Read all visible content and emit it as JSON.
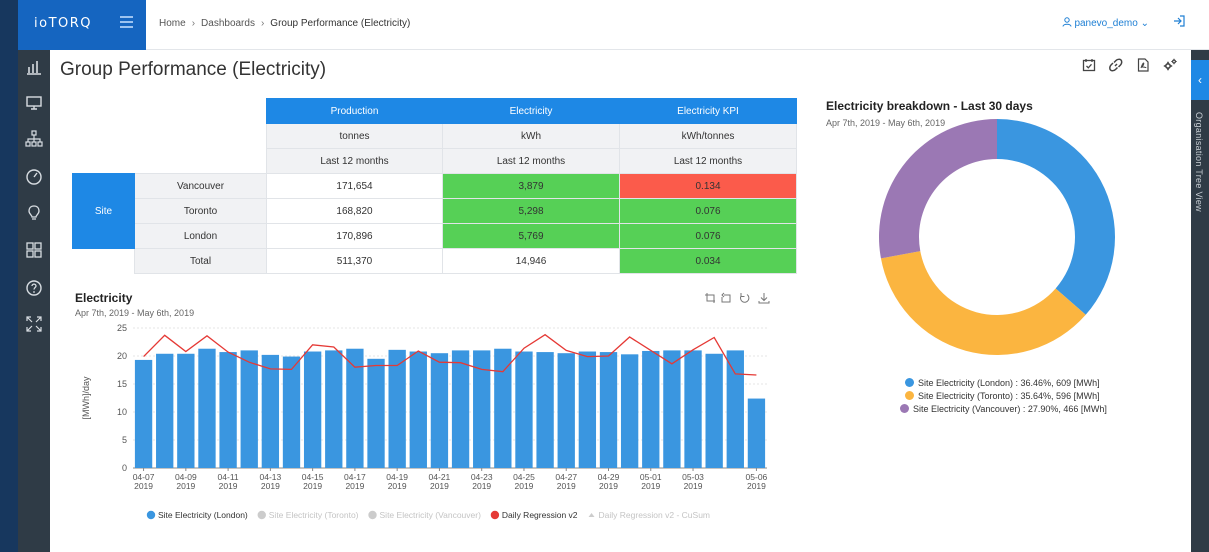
{
  "brand": {
    "name": "ioTORQ"
  },
  "breadcrumb": {
    "items": [
      "Home",
      "Dashboards",
      "Group Performance (Electricity)"
    ]
  },
  "user": {
    "name": "panevo_demo"
  },
  "page": {
    "title": "Group Performance (Electricity)"
  },
  "toolbar": {
    "icons": [
      "calendar-check-icon",
      "link-icon",
      "pdf-icon",
      "settings-gears-icon"
    ]
  },
  "nav": {
    "icons": [
      "bar-chart-icon",
      "monitor-icon",
      "hierarchy-icon",
      "gauge-icon",
      "lightbulb-icon",
      "grid-icon",
      "help-icon",
      "expand-icon"
    ]
  },
  "kpi_table": {
    "headers": [
      "Production",
      "Electricity",
      "Electricity KPI"
    ],
    "units": [
      "tonnes",
      "kWh",
      "kWh/tonnes"
    ],
    "periods": [
      "Last 12 months",
      "Last 12 months",
      "Last 12 months"
    ],
    "group_label": "Site",
    "rows": [
      {
        "label": "Vancouver",
        "production": "171,654",
        "electricity": "3,879",
        "kpi": "0.134"
      },
      {
        "label": "Toronto",
        "production": "168,820",
        "electricity": "5,298",
        "kpi": "0.076"
      },
      {
        "label": "London",
        "production": "170,896",
        "electricity": "5,769",
        "kpi": "0.076"
      }
    ],
    "total": {
      "label": "Total",
      "production": "511,370",
      "electricity": "14,946",
      "kpi": "0.034"
    },
    "colors": {
      "header": "#1e88e5",
      "good": "#56d056",
      "bad": "#fb5b4b"
    }
  },
  "electricity_chart": {
    "title": "Electricity",
    "range": "Apr 7th, 2019   -   May 6th, 2019",
    "tool_icons": [
      "zoom-area-icon",
      "zoom-reset-icon",
      "restore-icon",
      "download-icon"
    ]
  },
  "breakdown": {
    "title": "Electricity breakdown - Last 30 days",
    "range": "Apr 7th, 2019   -   May 6th, 2019"
  },
  "right_panel": {
    "label": "Organisation Tree View"
  },
  "chart_data": [
    {
      "type": "bar",
      "ylabel": "[MWh]/day",
      "ylim": [
        0,
        25
      ],
      "yticks": [
        "0",
        "5",
        "10",
        "15",
        "20",
        "25"
      ],
      "x": [
        "04-07",
        "04-08",
        "04-09",
        "04-10",
        "04-11",
        "04-12",
        "04-13",
        "04-14",
        "04-15",
        "04-16",
        "04-17",
        "04-18",
        "04-19",
        "04-20",
        "04-21",
        "04-22",
        "04-23",
        "04-24",
        "04-25",
        "04-26",
        "04-27",
        "04-28",
        "04-29",
        "04-30",
        "05-01",
        "05-02",
        "05-03",
        "05-04",
        "05-05",
        "05-06"
      ],
      "tick_labels": [
        {
          "top": "04-07",
          "bottom": "2019"
        },
        {
          "top": "04-09",
          "bottom": "2019"
        },
        {
          "top": "04-11",
          "bottom": "2019"
        },
        {
          "top": "04-13",
          "bottom": "2019"
        },
        {
          "top": "04-15",
          "bottom": "2019"
        },
        {
          "top": "04-17",
          "bottom": "2019"
        },
        {
          "top": "04-19",
          "bottom": "2019"
        },
        {
          "top": "04-21",
          "bottom": "2019"
        },
        {
          "top": "04-23",
          "bottom": "2019"
        },
        {
          "top": "04-25",
          "bottom": "2019"
        },
        {
          "top": "04-27",
          "bottom": "2019"
        },
        {
          "top": "04-29",
          "bottom": "2019"
        },
        {
          "top": "05-01",
          "bottom": "2019"
        },
        {
          "top": "05-03",
          "bottom": "2019"
        },
        {
          "top": "05-06",
          "bottom": "2019"
        }
      ],
      "series": [
        {
          "name": "Site Electricity (London)",
          "kind": "bar",
          "color": "#3a96e0",
          "visible": true,
          "values": [
            19.3,
            20.4,
            20.4,
            21.3,
            20.7,
            21.0,
            20.2,
            19.9,
            20.8,
            21.0,
            21.3,
            19.5,
            21.1,
            20.8,
            20.5,
            21.0,
            21.0,
            21.3,
            20.8,
            20.7,
            20.5,
            20.8,
            20.7,
            20.3,
            20.9,
            21.0,
            21.0,
            20.4,
            21.0,
            12.4
          ]
        },
        {
          "name": "Site Electricity (Toronto)",
          "kind": "bar",
          "color": "#cccccc",
          "visible": false
        },
        {
          "name": "Site Electricity (Vancouver)",
          "kind": "bar",
          "color": "#cccccc",
          "visible": false
        },
        {
          "name": "Daily Regression v2",
          "kind": "line",
          "color": "#e53935",
          "visible": true,
          "values": [
            19.9,
            23.7,
            20.8,
            23.6,
            20.7,
            18.9,
            17.7,
            17.6,
            22.0,
            21.6,
            18.0,
            18.3,
            18.3,
            20.9,
            18.9,
            18.8,
            17.6,
            17.2,
            21.4,
            23.8,
            21.0,
            19.9,
            20.0,
            23.4,
            21.0,
            18.6,
            21.1,
            23.3,
            16.8,
            16.6
          ]
        },
        {
          "name": "Daily Regression v2 - CuSum",
          "kind": "line",
          "color": "#cccccc",
          "visible": false
        }
      ]
    },
    {
      "type": "pie",
      "title": "Electricity breakdown - Last 30 days",
      "slices": [
        {
          "label": "Site Electricity (London) : 36.46%, 609 [MWh]",
          "name": "Site Electricity (London)",
          "percent": 36.46,
          "value": 609,
          "color": "#3a96e0"
        },
        {
          "label": "Site Electricity (Toronto) : 35.64%, 596 [MWh]",
          "name": "Site Electricity (Toronto)",
          "percent": 35.64,
          "value": 596,
          "color": "#fbb540"
        },
        {
          "label": "Site Electricity (Vancouver) : 27.90%, 466 [MWh]",
          "name": "Site Electricity (Vancouver)",
          "percent": 27.9,
          "value": 466,
          "color": "#9b78b4"
        }
      ]
    }
  ]
}
